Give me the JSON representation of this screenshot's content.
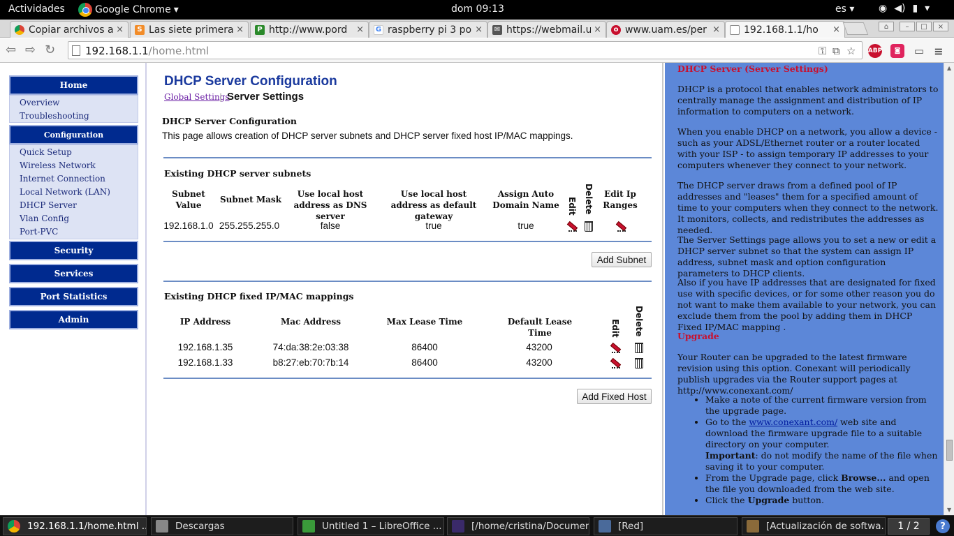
{
  "system": {
    "activities": "Actividades",
    "app_menu": "Google Chrome",
    "clock": "dom 09:13",
    "lang": "es"
  },
  "tabs": [
    {
      "title": "Copiar archivos a",
      "favicon": "chrome-icon"
    },
    {
      "title": "Las siete primera",
      "favicon": "smt-icon"
    },
    {
      "title": "http://www.pord",
      "favicon": "p-icon"
    },
    {
      "title": "raspberry pi 3 po",
      "favicon": "google-icon"
    },
    {
      "title": "https://webmail.u",
      "favicon": "mail-icon"
    },
    {
      "title": "www.uam.es/per",
      "favicon": "uam-icon"
    },
    {
      "title": "192.168.1.1/ho",
      "favicon": "page-icon"
    }
  ],
  "omnibox": {
    "host": "192.168.1.1",
    "path": "/home.html"
  },
  "sidebar": {
    "home": "Home",
    "home_items": [
      "Overview",
      "Troubleshooting"
    ],
    "configuration": "Configuration",
    "config_items": [
      "Quick Setup",
      "Wireless Network",
      "Internet Connection",
      "Local Network (LAN)",
      "DHCP Server",
      "Vlan Config",
      "Port-PVC"
    ],
    "security": "Security",
    "services": "Services",
    "port_statistics": "Port Statistics",
    "admin": "Admin"
  },
  "main": {
    "title": "DHCP Server Configuration",
    "crumb_link": "Global Settings",
    "crumb_sep": "|",
    "crumb_current": "Server Settings",
    "section_title": "DHCP Server Configuration",
    "description": "This page allows creation of DHCP server subnets and DHCP server fixed host IP/MAC mappings.",
    "subnets": {
      "heading": "Existing DHCP server subnets",
      "headers": [
        "Subnet Value",
        "Subnet Mask",
        "Use local host address as DNS server",
        "Use local host address as default gateway",
        "Assign Auto Domain Name",
        "Edit",
        "Delete",
        "Edit Ip Ranges"
      ],
      "rows": [
        {
          "subnet": "192.168.1.0",
          "mask": "255.255.255.0",
          "dns": "false",
          "gateway": "true",
          "domain": "true"
        }
      ],
      "add_button": "Add Subnet"
    },
    "fixed": {
      "heading": "Existing DHCP fixed IP/MAC mappings",
      "headers": [
        "IP Address",
        "Mac Address",
        "Max Lease Time",
        "Default Lease Time",
        "Edit",
        "Delete"
      ],
      "rows": [
        {
          "ip": "192.168.1.35",
          "mac": "74:da:38:2e:03:38",
          "max": "86400",
          "def": "43200"
        },
        {
          "ip": "192.168.1.33",
          "mac": "b8:27:eb:70:7b:14",
          "max": "86400",
          "def": "43200"
        }
      ],
      "add_button": "Add Fixed Host"
    }
  },
  "help": {
    "h1": "DHCP Server (Server Settings)",
    "p1": "DHCP is a protocol that enables network administrators to centrally manage the assignment and distribution of IP information to computers on a network.",
    "p2": "When you enable DHCP on a network, you allow a device - such as your ADSL/Ethernet router or a router located with your ISP - to assign temporary IP addresses to your computers whenever they connect to your network.",
    "p3": "The DHCP server draws from a defined pool of IP addresses and \"leases\" them for a specified amount of time to your computers when they connect to the network. It monitors, collects, and redistributes the addresses as needed.",
    "p4": "The Server Settings page allows you to set a new or edit a DHCP server subnet so that the system can assign IP address, subnet mask and option configuration parameters to DHCP clients.",
    "p5": "Also if you have IP addresses that are designated for fixed use with specific devices, or for some other reason you do not want to make them available to your network, you can exclude them from the pool by adding them in DHCP Fixed IP/MAC mapping .",
    "h2": "Upgrade",
    "p6": "Your Router can be upgraded to the latest firmware revision using this option. Conexant will periodically publish upgrades via the Router support pages at http://www.conexant.com/",
    "li1": "Make a note of the current firmware version from the upgrade page.",
    "li2_pre": "Go to the ",
    "li2_link": "www.conexant.com/",
    "li2_post": " web site and download the firmware upgrade file to a suitable directory on your computer.",
    "li2_important": "Important",
    "li2_imp_text": ": do not modify the name of the file when saving it to your computer.",
    "li3_pre": "From the Upgrade page, click ",
    "li3_bold": "Browse...",
    "li3_post": " and open the file you downloaded from the web site.",
    "li4_pre": "Click the ",
    "li4_bold": "Upgrade",
    "li4_post": " button."
  },
  "taskbar": {
    "items": [
      "192.168.1.1/home.html ...",
      "Descargas",
      "Untitled 1 – LibreOffice ...",
      "[/home/cristina/Documen...",
      "[Red]",
      "[Actualización de softwa..."
    ],
    "pager": "1 / 2"
  },
  "colors": {
    "nav_header": "#002a8f",
    "title_blue": "#1b3a9e",
    "help_bg": "#5c87d8",
    "help_heading": "#c8102e"
  }
}
